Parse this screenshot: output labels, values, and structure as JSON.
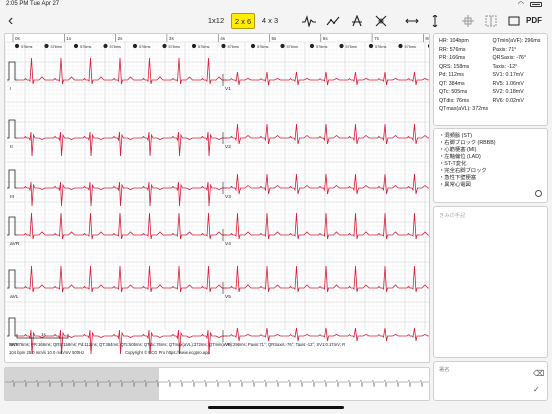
{
  "status": {
    "time": "2:05 PM",
    "date": "Tue Apr 27",
    "wifi_icon": "wifi-icon",
    "battery_icon": "battery-icon"
  },
  "toolbar": {
    "back_icon": "chevron-left-icon",
    "layouts": [
      "1x12",
      "2 x 6",
      "4 x 3"
    ],
    "active_layout": "2 x 6",
    "tools": [
      "wave-icon",
      "line-chart-icon",
      "a-measure-icon",
      "cross-icon",
      "horizontal-resize-icon",
      "vertical-resize-icon",
      "crosshair-icon",
      "selection-frame-icon",
      "crop-icon"
    ],
    "pdf_label": "PDF"
  },
  "ecg": {
    "time_markers": [
      "0s",
      "1s",
      "2s",
      "3s",
      "4s",
      "5s",
      "6s",
      "7s",
      "8s"
    ],
    "interval_labels": [
      "576ms",
      "576ms",
      "576ms",
      "576ms",
      "576ms",
      "576ms",
      "576ms",
      "576ms",
      "576ms",
      "576ms",
      "576ms",
      "576ms",
      "576ms",
      "576ms",
      "576ms"
    ],
    "leads_left": [
      "I",
      "II",
      "III",
      "aVR",
      "aVL",
      "aVF"
    ],
    "leads_right": [
      "V1",
      "V2",
      "V3",
      "V4",
      "V5",
      "V6"
    ],
    "scale_label": "1s",
    "footer_line1": "RR:576ms; PR:166ms; QRS:158ms; Pd:112ms; QT:384ms; QTc:505ms; QTdic:76ms; QTmax(aVL):372ms; QTmin(aVF):296ms; Paxis:71°; QRSaxis:-76°; Taxis:-12°; SV1:0.17mV; R",
    "footer_line2a": "104 bpm  25.0 mm/s  10.0 mm/mV  500Hz",
    "footer_line2b": "Copyright © ECG Pro https://www.ecgpro.app",
    "colors": {
      "trace": "#d81f3a",
      "grid_minor": "#ececec",
      "grid_major": "#d6d6d6"
    }
  },
  "measurements": {
    "left": [
      "HR: 104bpm",
      "RR: 576ms",
      "PR: 166ms",
      "QRS: 158ms",
      "Pd: 112ms",
      "QT: 384ms",
      "QTc: 505ms",
      "QTdis: 76ms",
      "QTmax(aVL): 372ms"
    ],
    "right": [
      "QTmin(aVF): 296ms",
      "Paxis: 71°",
      "QRSaxis: -76°",
      "Taxis: -12°",
      "SV1: 0.17mV",
      "RV5: 1.06mV",
      "SV2: 0.18mV",
      "RV6: 0.02mV",
      ""
    ]
  },
  "diagnosis": {
    "items": [
      "・洞頻脈 (ST)",
      "・右脚ブロック (RBBB)",
      "・心筋梗塞 (MI)",
      "・左軸偏位 (LAD)",
      "・ST-T変化",
      "・完全右脚ブロック",
      "・急性下壁梗塞",
      "・異常心電図"
    ],
    "toggle_icon": "circle-toggle-icon"
  },
  "memo": {
    "placeholder": "きみの手記"
  },
  "sign": {
    "label": "署名",
    "eraser_icon": "eraser-icon",
    "check_icon": "checkmark-icon"
  }
}
